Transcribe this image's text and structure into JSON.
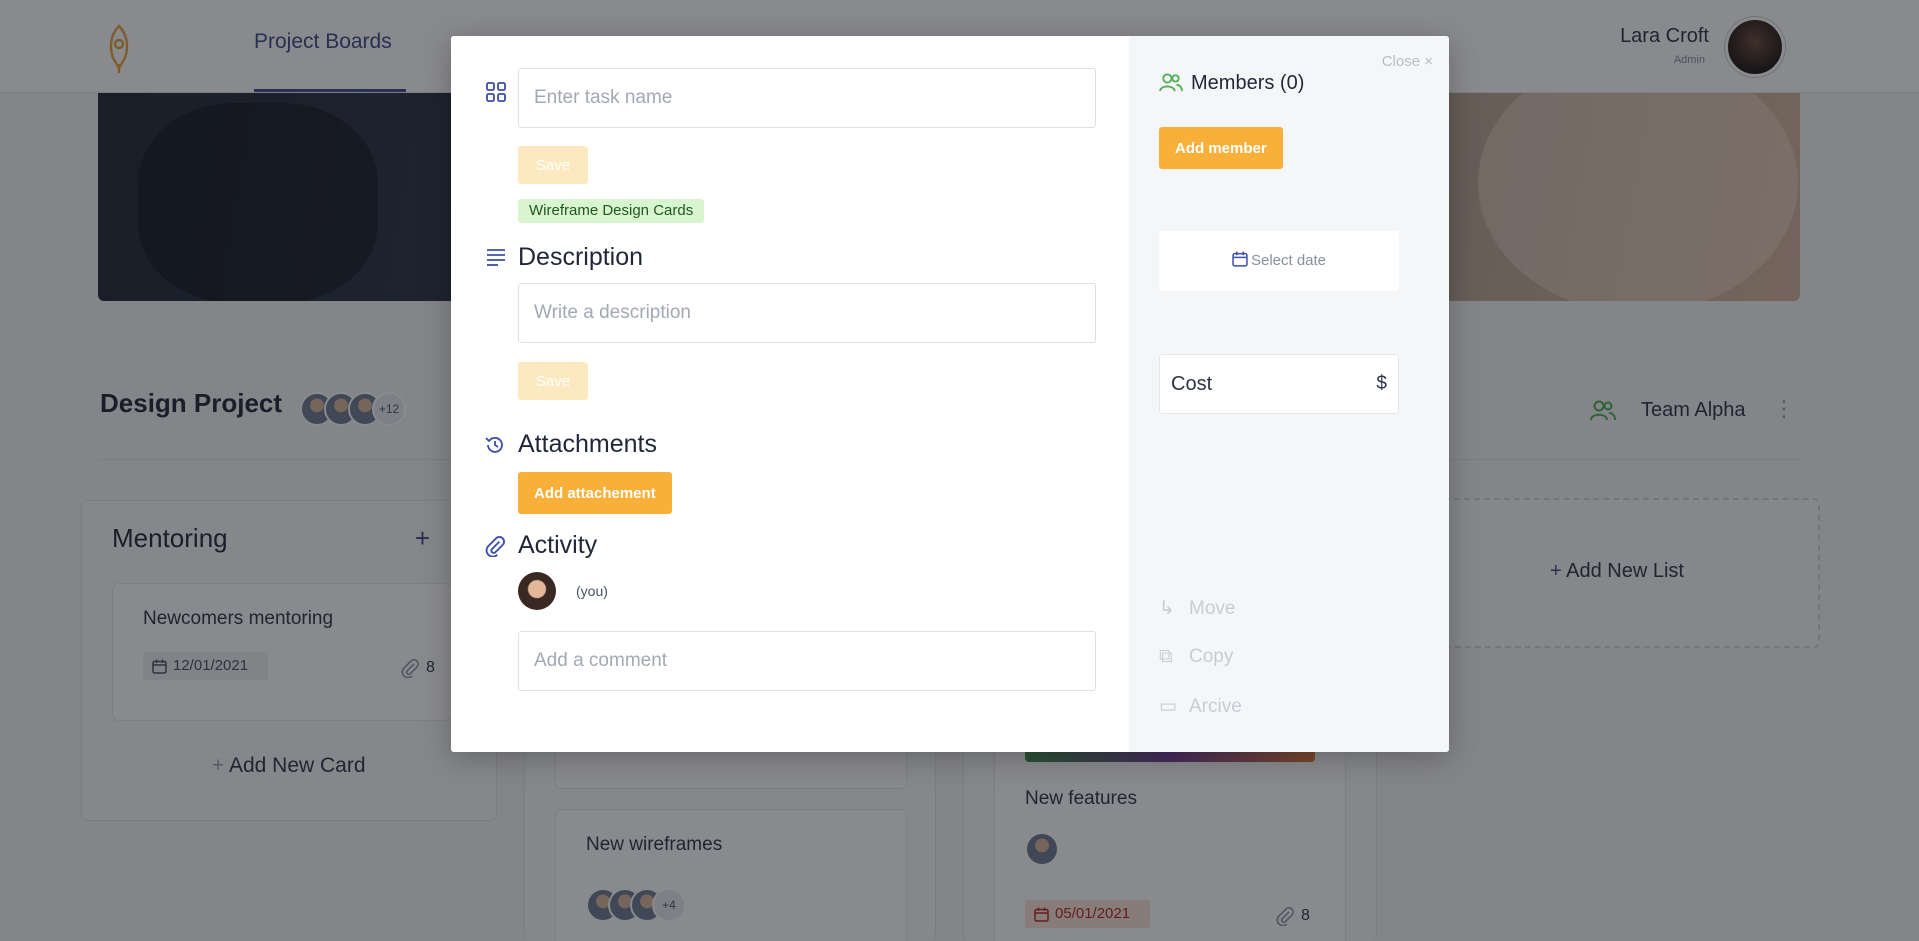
{
  "header": {
    "nav_tab": "Project Boards",
    "user_name": "Lara Croft",
    "user_role": "Admin"
  },
  "project": {
    "title": "Design Project",
    "more_members": "+12",
    "team_name": "Team Alpha"
  },
  "lists": [
    {
      "title": "Mentoring",
      "cards": [
        {
          "title": "Newcomers mentoring",
          "date": "12/01/2021",
          "attachments": "8"
        }
      ],
      "add_card_label": "Add New Card"
    },
    {
      "cards": [
        {
          "title": "New wireframes",
          "more_members": "+4"
        }
      ]
    },
    {
      "cards": [
        {
          "title": "New features",
          "date": "05/01/2021",
          "attachments": "8"
        }
      ]
    }
  ],
  "add_list_label": "Add New List",
  "modal": {
    "task_name_placeholder": "Enter task name",
    "save_label": "Save",
    "label_chip": "Wireframe Design Cards",
    "description_title": "Description",
    "description_placeholder": "Write a description",
    "attachments_title": "Attachments",
    "add_attachment_label": "Add attachement",
    "activity_title": "Activity",
    "you_label": "(you)",
    "comment_placeholder": "Add a comment",
    "close_label": "Close ×",
    "members_title": "Members (0)",
    "add_member_label": "Add member",
    "select_date_label": "Select date",
    "cost_label": "Cost",
    "cost_currency": "$",
    "actions": {
      "move": "Move",
      "copy": "Copy",
      "archive": "Arcive"
    }
  },
  "colors": {
    "accent_orange": "#f9b03a",
    "accent_blue": "#3d4fa8",
    "label_green": "#d9f5cf"
  }
}
